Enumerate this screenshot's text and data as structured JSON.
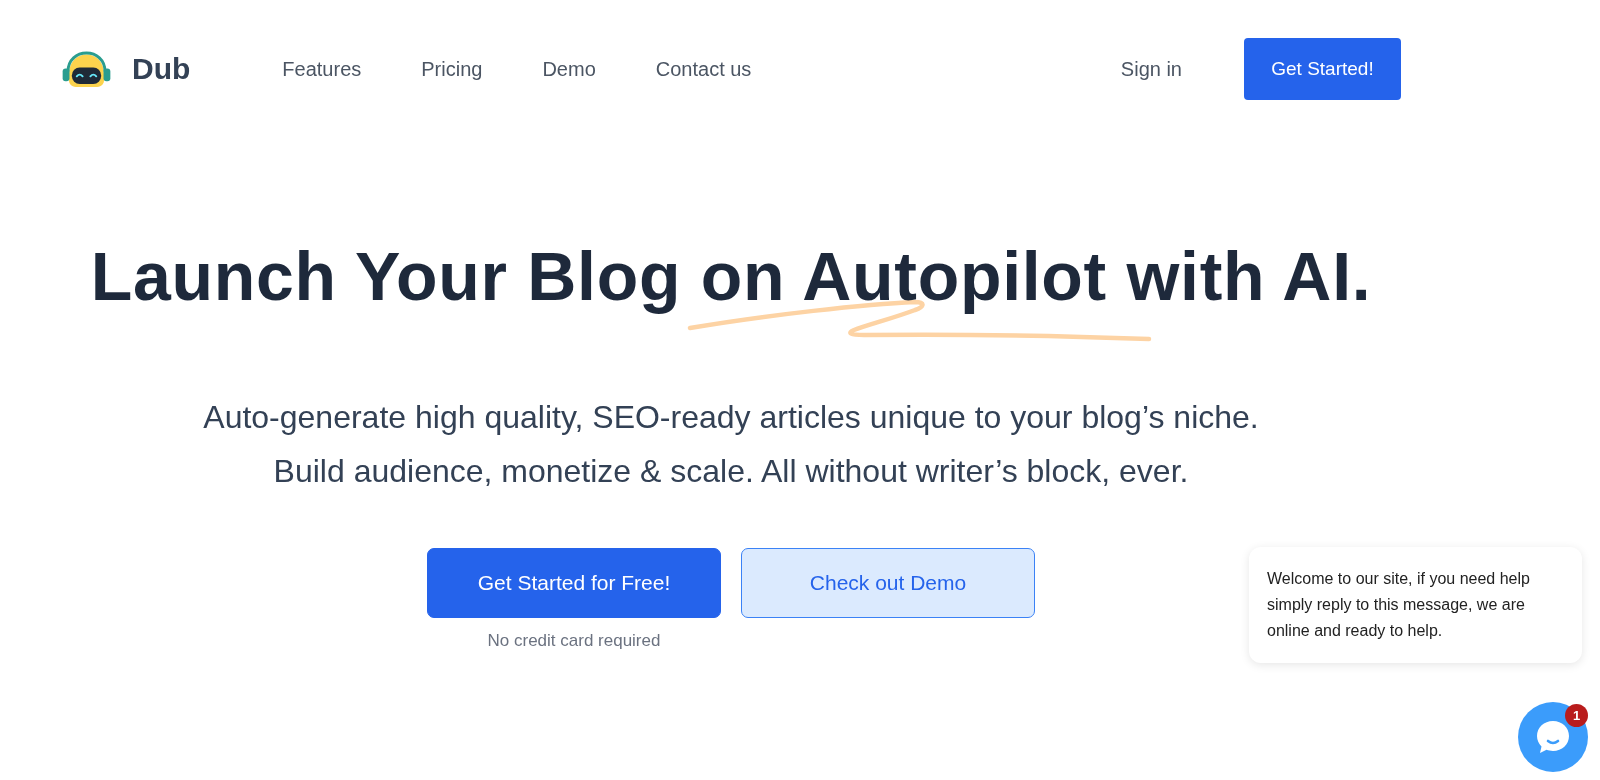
{
  "header": {
    "brand": "Dub",
    "nav": [
      "Features",
      "Pricing",
      "Demo",
      "Contact us"
    ],
    "sign_in": "Sign in",
    "cta": "Get Started!"
  },
  "hero": {
    "headline": "Launch Your Blog on Autopilot with AI.",
    "subtitle_lines": [
      "Auto-generate high quality, SEO-ready articles unique to your blog’s niche.",
      "Build audience, monetize & scale. All without writer’s block, ever."
    ],
    "primary_button": "Get Started for Free!",
    "secondary_button": "Check out Demo",
    "note": "No credit card required"
  },
  "chat": {
    "message": "Welcome to our site, if you need help simply reply to this message, we are online and ready to help.",
    "unread_badge": "1"
  }
}
